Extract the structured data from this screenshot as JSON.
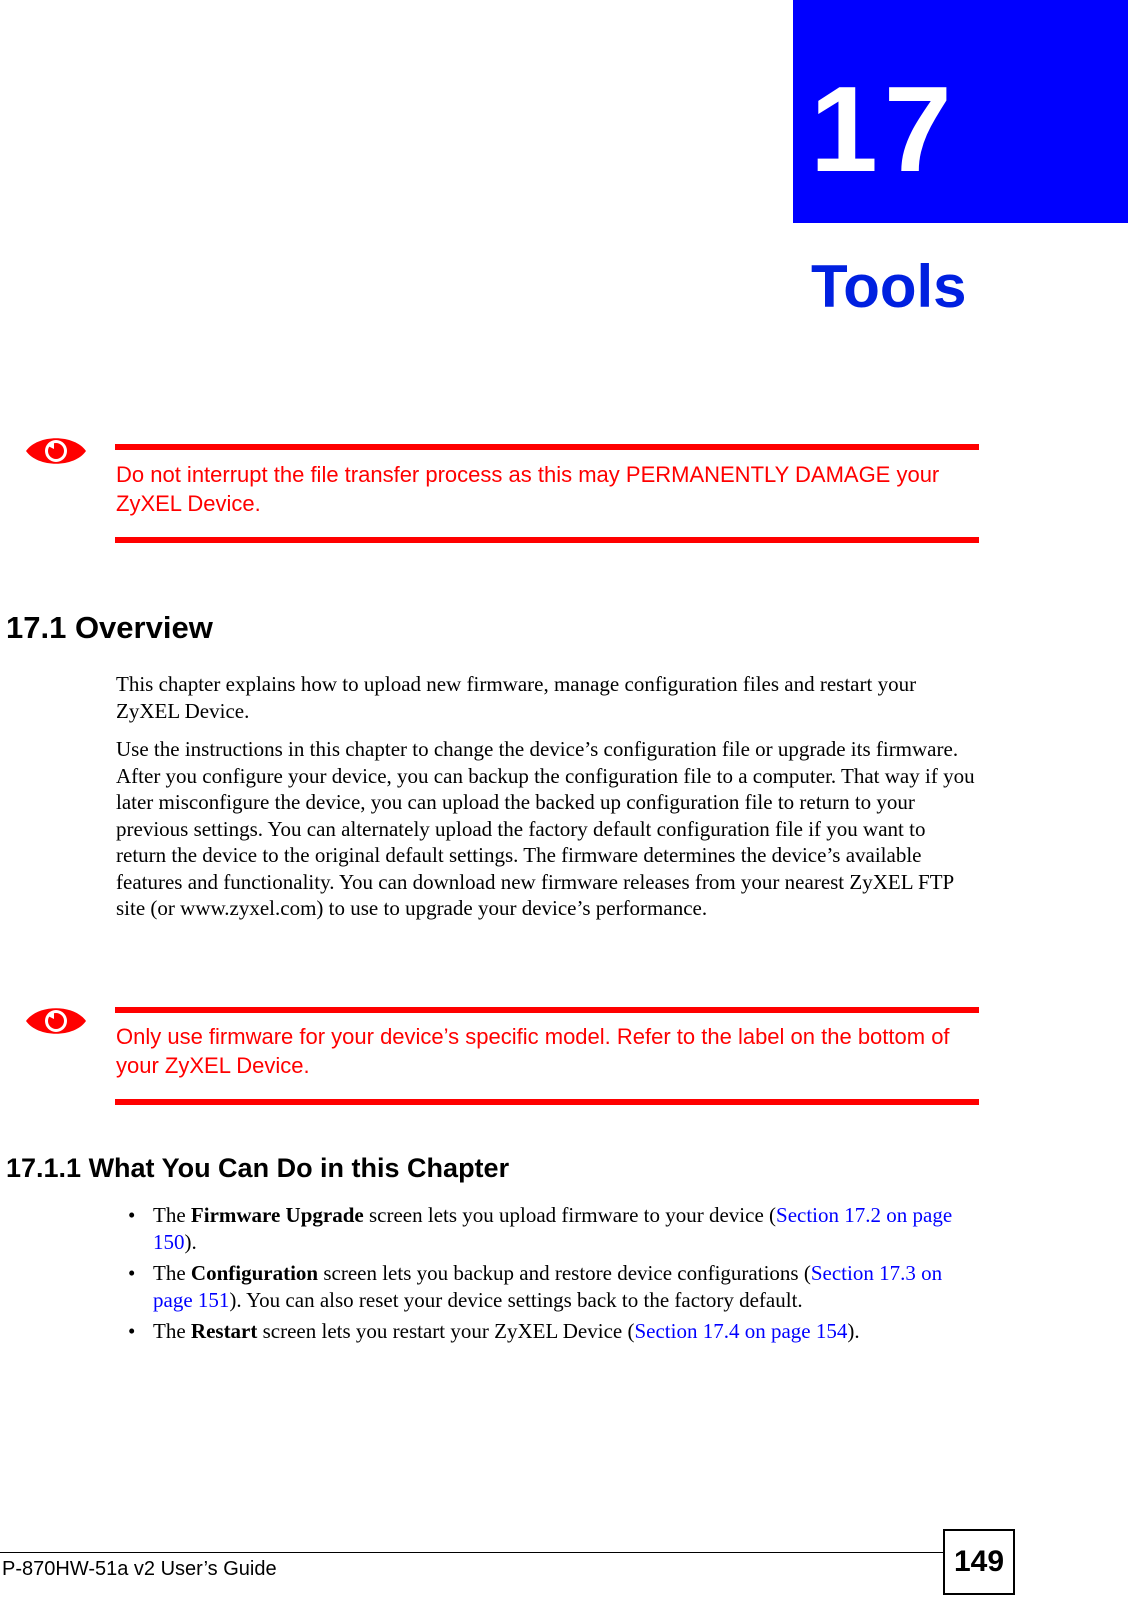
{
  "chapter": {
    "number": "17",
    "title": "Tools",
    "accent_color": "#0000ff"
  },
  "warnings": [
    {
      "icon": "warning-eye-icon",
      "text": "Do not interrupt the file transfer process as this may PERMANENTLY DAMAGE your ZyXEL Device."
    },
    {
      "icon": "warning-eye-icon",
      "text": "Only use firmware for your device’s specific model. Refer to the label on the bottom of your ZyXEL Device."
    }
  ],
  "section": {
    "heading": "17.1  Overview",
    "paragraphs": [
      "This chapter explains how to upload new firmware, manage configuration files and restart your ZyXEL Device.",
      "Use the instructions in this chapter to change the device’s configuration file or upgrade its firmware. After you configure your device, you can backup the configuration file to a computer. That way if you later misconfigure the device, you can upload the backed up configuration file to return to your previous settings. You can alternately upload the factory default configuration file if you want to return the device to the original default settings. The firmware determines the device’s available features and functionality. You can download new firmware releases from your nearest ZyXEL FTP site (or www.zyxel.com) to use to upgrade your device’s performance."
    ]
  },
  "subsection": {
    "heading": "17.1.1  What You Can Do in this Chapter",
    "bullets": [
      {
        "prefix": "The ",
        "bold": "Firmware Upgrade",
        "middle": " screen lets you upload firmware to your device (",
        "link": "Section 17.2 on page 150",
        "suffix": ")."
      },
      {
        "prefix": "The ",
        "bold": "Configuration",
        "middle": " screen lets you backup and restore device configurations (",
        "link": "Section 17.3 on page 151",
        "suffix": "). You can also reset your device settings back to the factory default."
      },
      {
        "prefix": "The ",
        "bold": "Restart",
        "middle": " screen lets you restart your ZyXEL Device (",
        "link": "Section 17.4 on page 154",
        "suffix": ")."
      }
    ]
  },
  "footer": {
    "guide_title": "P-870HW-51a v2 User’s Guide",
    "page_number": "149"
  }
}
